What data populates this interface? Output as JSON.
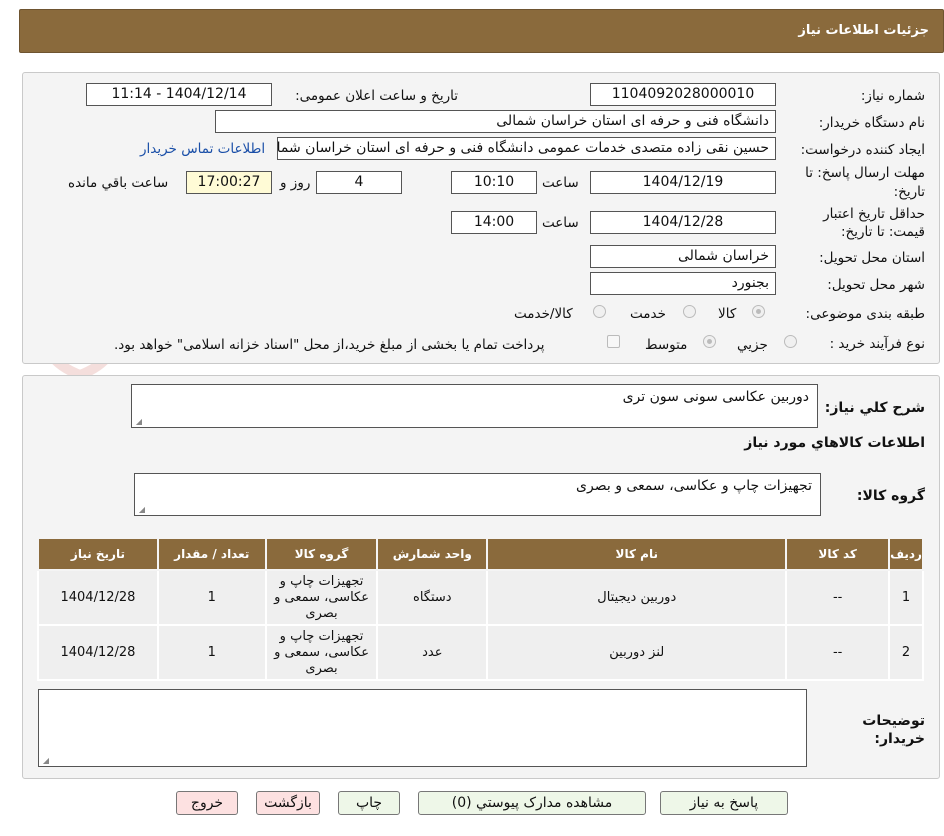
{
  "header": {
    "title": "جزئیات اطلاعات نیاز"
  },
  "watermark": {
    "text": "AriaTender.neT"
  },
  "form": {
    "need_number_label": "شماره نیاز:",
    "need_number": "1104092028000010",
    "announce_label": "تاریخ و ساعت اعلان عمومی:",
    "announce_value": "1404/12/14 - 11:14",
    "buyer_org_label": "نام دستگاه خریدار:",
    "buyer_org": "دانشگاه فنی و حرفه ای استان خراسان شمالی",
    "requester_label": "ایجاد کننده درخواست:",
    "requester": "حسین نقی زاده متصدی خدمات عمومی دانشگاه فنی و حرفه ای استان خراسان شمالی",
    "contact_link": "اطلاعات تماس خریدار",
    "deadline_label_1": "مهلت ارسال پاسخ: تا",
    "deadline_label_2": "تاریخ:",
    "deadline_date": "1404/12/19",
    "time_label": "ساعت",
    "deadline_time": "10:10",
    "days_value": "4",
    "days_label": "روز و",
    "remaining_time": "17:00:27",
    "remaining_label": "ساعت باقي مانده",
    "validity_label_1": "حداقل تاریخ اعتبار",
    "validity_label_2": "قیمت: تا تاریخ:",
    "validity_date": "1404/12/28",
    "validity_time_label": "ساعت",
    "validity_time": "14:00",
    "province_label": "استان محل تحویل:",
    "province": "خراسان شمالی",
    "city_label": "شهر محل تحویل:",
    "city": "بجنورد",
    "category_label": "طبقه بندی موضوعی:",
    "category_options": [
      "کالا",
      "خدمت",
      "کالا/خدمت"
    ],
    "process_label": "نوع فرآیند خرید :",
    "process_options": [
      "جزیي",
      "متوسط"
    ],
    "payment_note": "پرداخت تمام یا بخشی از مبلغ خرید،از محل \"اسناد خزانه اسلامی\" خواهد بود."
  },
  "details": {
    "general_desc_label": "شرح کلي نیاز:",
    "general_desc": "دوربین عکاسی سونی  سون تری",
    "goods_info_title": "اطلاعات کالاهاي مورد نیاز",
    "goods_group_label": "گروه کالا:",
    "goods_group": "تجهیزات چاپ و عکاسی، سمعی و بصری",
    "table": {
      "headers": [
        "ردیف",
        "کد کالا",
        "نام کالا",
        "واحد شمارش",
        "گروه کالا",
        "تعداد / مقدار",
        "تاریخ نیاز"
      ],
      "rows": [
        [
          "1",
          "--",
          "دوربین دیجیتال",
          "دستگاه",
          "تجهیزات چاپ و عکاسی، سمعی و بصری",
          "1",
          "1404/12/28"
        ],
        [
          "2",
          "--",
          "لنز دوربین",
          "عدد",
          "تجهیزات چاپ و عکاسی، سمعی و بصری",
          "1",
          "1404/12/28"
        ]
      ]
    },
    "buyer_notes_label_1": "توضیحات",
    "buyer_notes_label_2": "خریدار:",
    "buyer_notes": ""
  },
  "buttons": {
    "reply": "پاسخ به نیاز",
    "attachments": "مشاهده مدارک پیوستي (0)",
    "print": "چاپ",
    "back": "بازگشت",
    "exit": "خروج"
  }
}
